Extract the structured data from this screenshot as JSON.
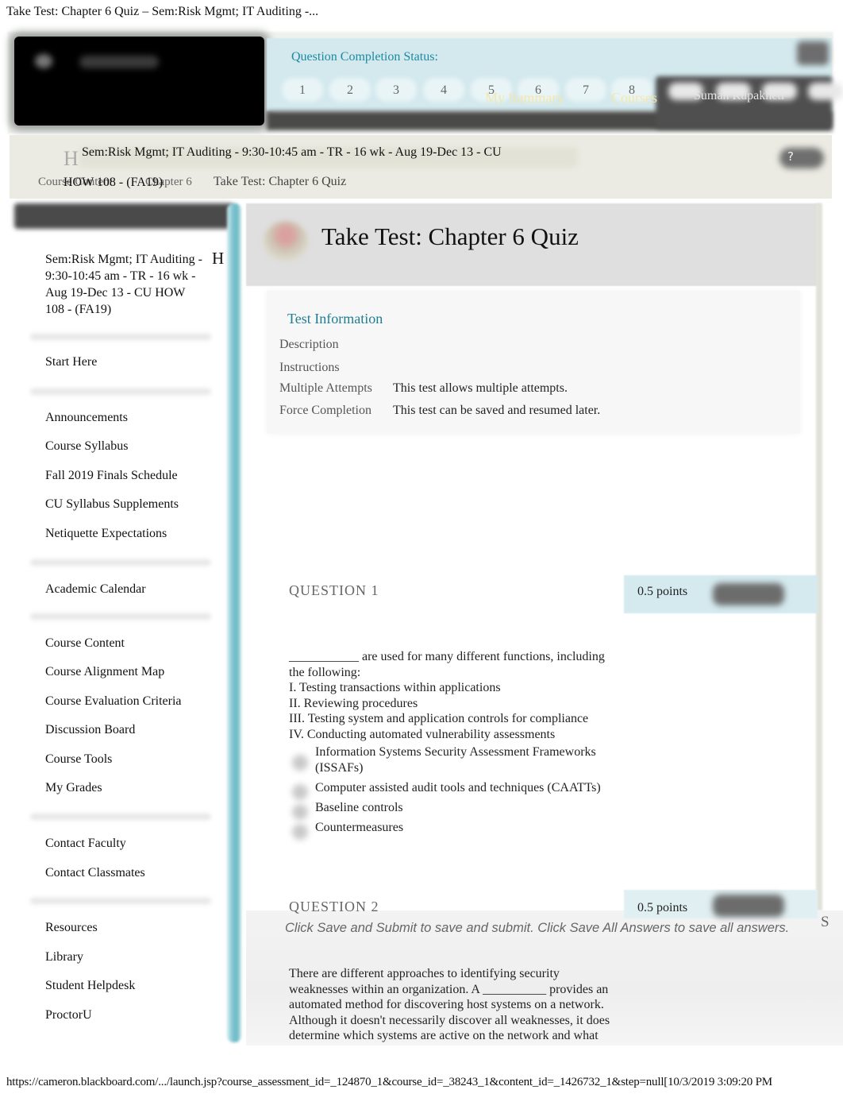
{
  "print_header": {
    "title": "Take Test: Chapter 6 Quiz – Sem:Risk Mgmt; IT Auditing -..."
  },
  "header": {
    "completion_label": "Question Completion Status:",
    "question_numbers": [
      "1",
      "2",
      "3",
      "4",
      "5",
      "6",
      "7",
      "8"
    ],
    "nav": {
      "my_summary": "My Summary",
      "courses": "Courses",
      "user_name": "Suman Rupakheti"
    },
    "help_label": "?"
  },
  "breadcrumb": {
    "home_glyph": "H",
    "course_title_line1": "Sem:Risk Mgmt; IT Auditing - 9:30-10:45 am - TR - 16 wk - Aug 19-Dec 13 - CU",
    "course_title_line2": "HOW 108 - (FA19)",
    "items": [
      "Course Content",
      "Chapter 6",
      "Take Test: Chapter 6 Quiz"
    ]
  },
  "sidebar": {
    "course_name": "Sem:Risk Mgmt; IT Auditing - 9:30-10:45 am - TR - 16 wk - Aug 19-Dec 13 - CU HOW 108 - (FA19)",
    "home_glyph": "H",
    "groups": [
      {
        "items": [
          {
            "label": "Start Here"
          }
        ]
      },
      {
        "items": [
          {
            "label": "Announcements"
          },
          {
            "label": "Course Syllabus"
          },
          {
            "label": "Fall 2019 Finals Schedule"
          },
          {
            "label": "CU Syllabus Supplements"
          },
          {
            "label": "Netiquette Expectations"
          }
        ]
      },
      {
        "items": [
          {
            "label": "Academic Calendar"
          }
        ]
      },
      {
        "items": [
          {
            "label": "Course Content"
          },
          {
            "label": "Course Alignment Map"
          },
          {
            "label": "Course Evaluation Criteria"
          },
          {
            "label": "Discussion Board"
          },
          {
            "label": "Course Tools"
          },
          {
            "label": "My Grades"
          }
        ]
      },
      {
        "items": [
          {
            "label": "Contact Faculty"
          },
          {
            "label": "Contact Classmates"
          }
        ]
      },
      {
        "items": [
          {
            "label": "Resources"
          },
          {
            "label": "Library"
          },
          {
            "label": "Student Helpdesk"
          },
          {
            "label": "ProctorU"
          }
        ]
      }
    ]
  },
  "page": {
    "title": "Take Test: Chapter 6 Quiz",
    "test_info": {
      "heading": "Test Information",
      "rows": [
        {
          "label": "Description",
          "value": ""
        },
        {
          "label": "Instructions",
          "value": ""
        },
        {
          "label": "Multiple Attempts",
          "value": "This test allows multiple attempts."
        },
        {
          "label": "Force Completion",
          "value": "This test can be saved and resumed later."
        }
      ]
    },
    "questions": [
      {
        "title": "QUESTION 1",
        "points": "0.5 points",
        "text_lines": [
          "___________ are used for many different functions, including",
          "the following:",
          "I. Testing transactions within applications",
          "II. Reviewing procedures",
          "III. Testing system and application controls for compliance",
          "IV. Conducting automated vulnerability assessments"
        ],
        "answers": [
          "Information Systems Security Assessment Frameworks (ISSAFs)",
          "Computer assisted audit tools and techniques (CAATTs)",
          "Baseline controls",
          "Countermeasures"
        ]
      },
      {
        "title": "QUESTION 2",
        "points": "0.5 points",
        "text_lines": [
          "There are different approaches to identifying security",
          "weaknesses within an organization. A __________ provides an",
          "automated method for discovering host systems on a network.",
          "Although it doesn't necessarily discover all weaknesses, it does",
          "determine which systems are active on the network and what"
        ]
      }
    ],
    "submit_hint": "Click Save and Submit to save and submit. Click Save All Answers to save all answers.",
    "save_truncated": "S"
  },
  "footer": {
    "url": "https://cameron.blackboard.com/.../launch.jsp?course_assessment_id=_124870_1&course_id=_38243_1&content_id=_1426732_1&step=null[10/3/2019 3:09:20 PM"
  },
  "colors": {
    "accent_teal": "#1d8aa2",
    "status_band": "#d3e9ee",
    "nav_link_yellow": "#f4e7a8"
  }
}
